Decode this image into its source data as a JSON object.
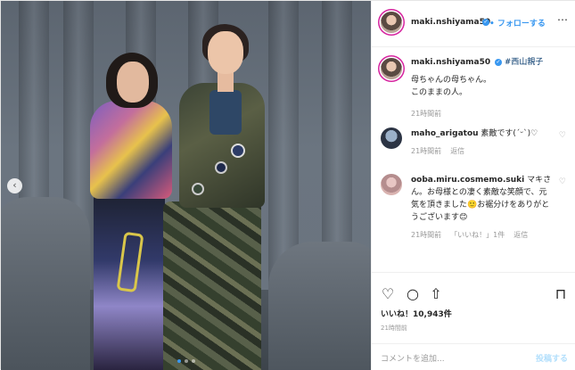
{
  "header": {
    "username": "maki.nshiyama50",
    "separator": "•",
    "follow_label": "フォローする",
    "more_icon": "more-icon"
  },
  "caption": {
    "username": "maki.nshiyama50",
    "hashtag": "#西山親子",
    "line1": "母ちゃんの母ちゃん。",
    "line2": "このままの人。",
    "time": "21時間前"
  },
  "comments": [
    {
      "username": "maho_arigatou",
      "text": "素敵です(´ᵕ`)♡",
      "time": "21時間前",
      "reply": "返信"
    },
    {
      "username": "ooba.miru.cosmemo.suki",
      "text": "マキさん。お母様との凄く素敵な笑顔で、元気を頂きました🙂お裾分けをありがとうございます😊",
      "time": "21時間前",
      "likes": "「いいね！」1件",
      "reply": "返信"
    }
  ],
  "actions": {
    "likes_label": "いいね！10,943件",
    "timestamp": "21時間前"
  },
  "add_comment": {
    "placeholder": "コメントを追加...",
    "post_label": "投稿する"
  },
  "colors": {
    "accent": "#3897f0",
    "hashtag": "#003569",
    "muted": "#999999"
  }
}
